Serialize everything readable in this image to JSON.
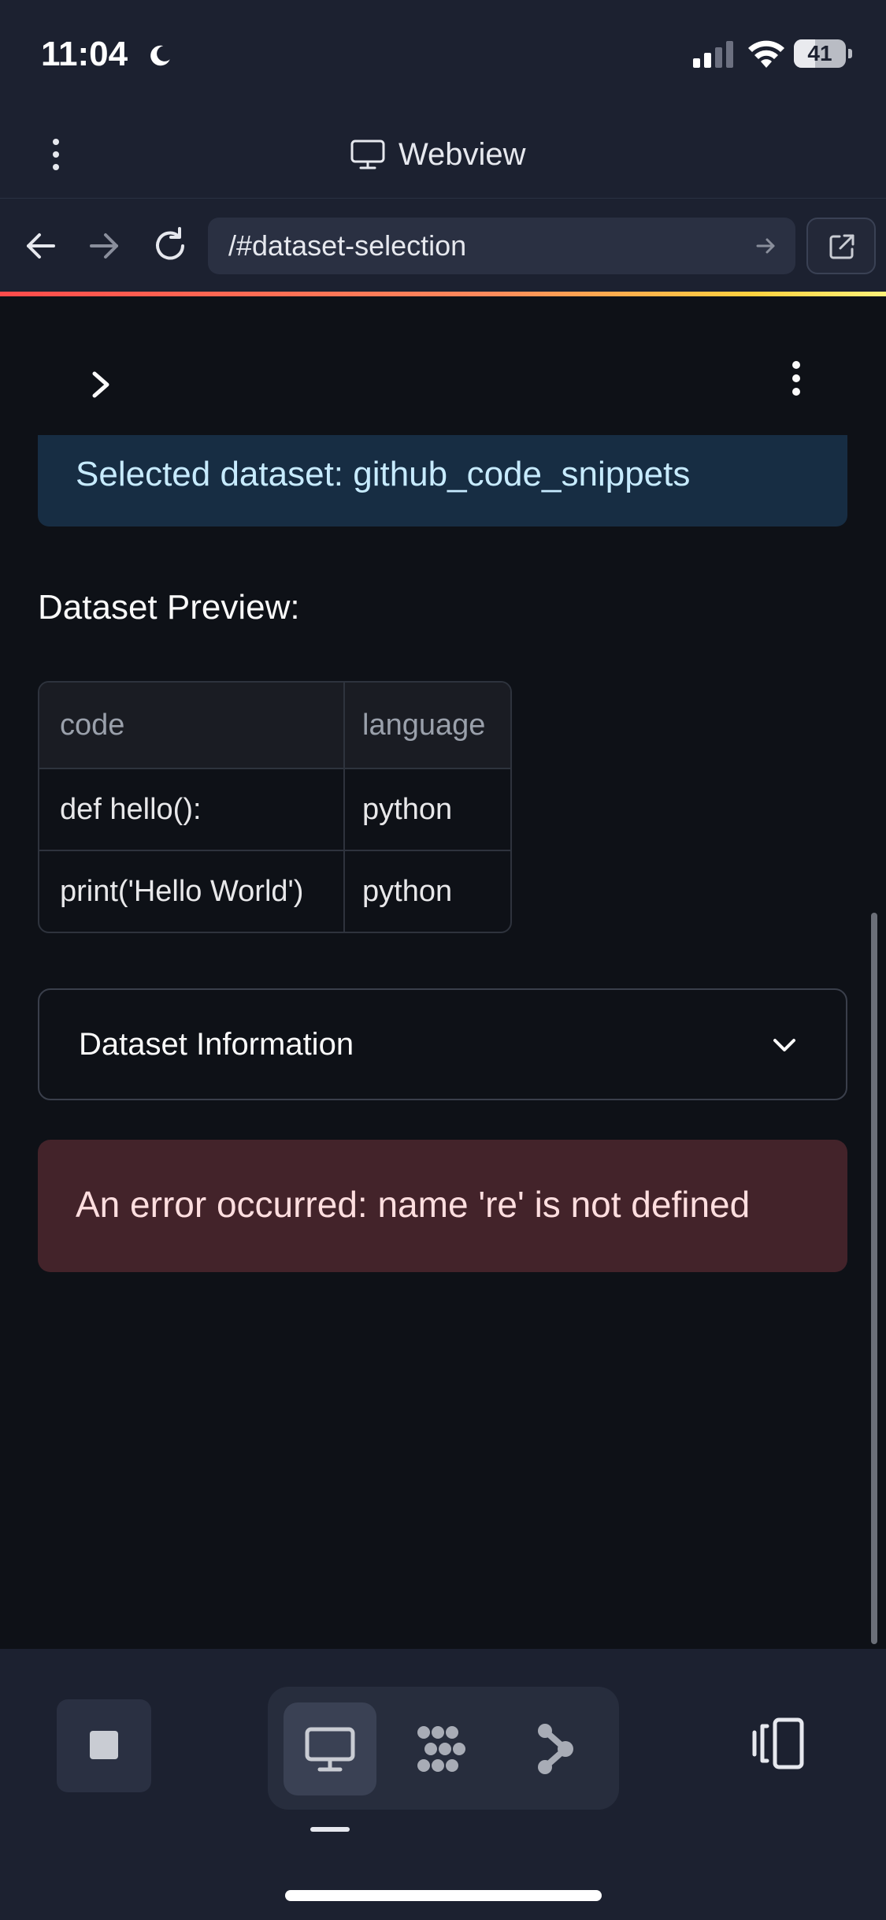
{
  "status_bar": {
    "time": "11:04",
    "battery": "41",
    "battery_level": 0.41
  },
  "webview": {
    "title": "Webview"
  },
  "nav": {
    "url": "/#dataset-selection"
  },
  "content": {
    "selected_dataset": "Selected dataset: github_code_snippets",
    "preview_label": "Dataset Preview:",
    "table": {
      "columns": [
        "code",
        "language"
      ],
      "rows": [
        [
          "def hello():",
          "python"
        ],
        [
          "print('Hello World')",
          "python"
        ]
      ]
    },
    "expander_label": "Dataset Information",
    "error_message": "An error occurred: name 're' is not defined"
  },
  "colors": {
    "accent_gradient_start": "#ff4b4b",
    "accent_gradient_end": "#fff27a",
    "info_background": "#172d43",
    "error_background": "#43232a"
  },
  "icons": {
    "status": [
      "moon-icon",
      "signal-icon",
      "wifi-icon",
      "battery-icon"
    ],
    "nav": [
      "back-arrow-icon",
      "forward-arrow-icon",
      "reload-icon",
      "go-arrow-icon",
      "open-external-icon"
    ],
    "toolbar": [
      "stop-icon",
      "monitor-icon",
      "grid-dots-icon",
      "graph-icon",
      "rotate-device-icon"
    ]
  }
}
